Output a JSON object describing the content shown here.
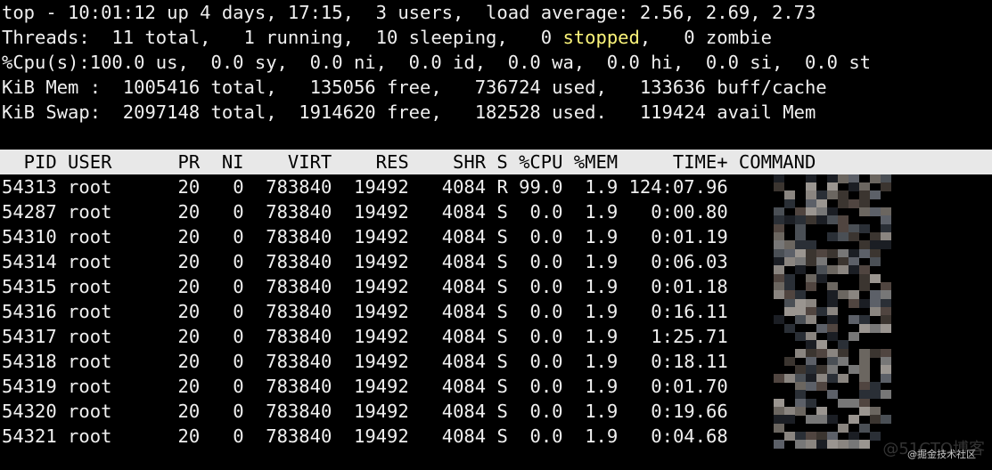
{
  "summary": {
    "line1": "top - 10:01:12 up 4 days, 17:15,  3 users,  load average: 2.56, 2.69, 2.73",
    "line2_pre": "Threads:  11 total,   1 running,  10 sleeping,   0 ",
    "line2_stopped": "stopped",
    "line2_post": ",   0 zombie",
    "line3": "%Cpu(s):100.0 us,  0.0 sy,  0.0 ni,  0.0 id,  0.0 wa,  0.0 hi,  0.0 si,  0.0 st",
    "line4": "KiB Mem :  1005416 total,   135056 free,   736724 used,   133636 buff/cache",
    "line5": "KiB Swap:  2097148 total,  1914620 free,   182528 used.   119424 avail Mem"
  },
  "table": {
    "header": "  PID USER      PR  NI    VIRT    RES    SHR S %CPU %MEM     TIME+ COMMAND",
    "rows": [
      {
        "pid": "54313",
        "user": "root",
        "pr": "20",
        "ni": "0",
        "virt": "783840",
        "res": "19492",
        "shr": "4084",
        "s": "R",
        "cpu": "99.0",
        "mem": "1.9",
        "time": "124:07.96"
      },
      {
        "pid": "54287",
        "user": "root",
        "pr": "20",
        "ni": "0",
        "virt": "783840",
        "res": "19492",
        "shr": "4084",
        "s": "S",
        "cpu": "0.0",
        "mem": "1.9",
        "time": "0:00.80"
      },
      {
        "pid": "54310",
        "user": "root",
        "pr": "20",
        "ni": "0",
        "virt": "783840",
        "res": "19492",
        "shr": "4084",
        "s": "S",
        "cpu": "0.0",
        "mem": "1.9",
        "time": "0:01.19"
      },
      {
        "pid": "54314",
        "user": "root",
        "pr": "20",
        "ni": "0",
        "virt": "783840",
        "res": "19492",
        "shr": "4084",
        "s": "S",
        "cpu": "0.0",
        "mem": "1.9",
        "time": "0:06.03"
      },
      {
        "pid": "54315",
        "user": "root",
        "pr": "20",
        "ni": "0",
        "virt": "783840",
        "res": "19492",
        "shr": "4084",
        "s": "S",
        "cpu": "0.0",
        "mem": "1.9",
        "time": "0:01.18"
      },
      {
        "pid": "54316",
        "user": "root",
        "pr": "20",
        "ni": "0",
        "virt": "783840",
        "res": "19492",
        "shr": "4084",
        "s": "S",
        "cpu": "0.0",
        "mem": "1.9",
        "time": "0:16.11"
      },
      {
        "pid": "54317",
        "user": "root",
        "pr": "20",
        "ni": "0",
        "virt": "783840",
        "res": "19492",
        "shr": "4084",
        "s": "S",
        "cpu": "0.0",
        "mem": "1.9",
        "time": "1:25.71"
      },
      {
        "pid": "54318",
        "user": "root",
        "pr": "20",
        "ni": "0",
        "virt": "783840",
        "res": "19492",
        "shr": "4084",
        "s": "S",
        "cpu": "0.0",
        "mem": "1.9",
        "time": "0:18.11"
      },
      {
        "pid": "54319",
        "user": "root",
        "pr": "20",
        "ni": "0",
        "virt": "783840",
        "res": "19492",
        "shr": "4084",
        "s": "S",
        "cpu": "0.0",
        "mem": "1.9",
        "time": "0:01.70"
      },
      {
        "pid": "54320",
        "user": "root",
        "pr": "20",
        "ni": "0",
        "virt": "783840",
        "res": "19492",
        "shr": "4084",
        "s": "S",
        "cpu": "0.0",
        "mem": "1.9",
        "time": "0:19.66"
      },
      {
        "pid": "54321",
        "user": "root",
        "pr": "20",
        "ni": "0",
        "virt": "783840",
        "res": "19492",
        "shr": "4084",
        "s": "S",
        "cpu": "0.0",
        "mem": "1.9",
        "time": "0:04.68"
      }
    ],
    "command_redacted": true
  },
  "watermark": {
    "primary": "@掘金技术社区",
    "secondary": "@51CTO博客"
  },
  "colors": {
    "background": "#000000",
    "text": "#f0f0f0",
    "highlight": "#fbf47a",
    "header_bg": "#e8e8e8"
  }
}
